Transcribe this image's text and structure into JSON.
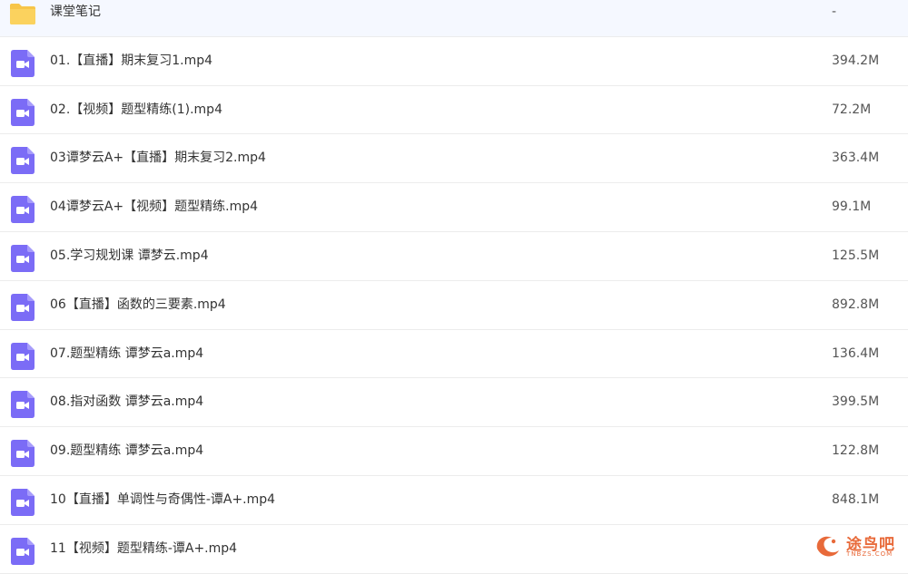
{
  "files": [
    {
      "name": "课堂笔记",
      "size": "-",
      "type": "folder",
      "icon": "folder-icon"
    },
    {
      "name": "01.【直播】期末复习1.mp4",
      "size": "394.2M",
      "type": "video",
      "icon": "video-icon"
    },
    {
      "name": "02.【视频】题型精练(1).mp4",
      "size": "72.2M",
      "type": "video",
      "icon": "video-icon"
    },
    {
      "name": "03谭梦云A+【直播】期末复习2.mp4",
      "size": "363.4M",
      "type": "video",
      "icon": "video-icon"
    },
    {
      "name": "04谭梦云A+【视频】题型精练.mp4",
      "size": "99.1M",
      "type": "video",
      "icon": "video-icon"
    },
    {
      "name": "05.学习规划课 谭梦云.mp4",
      "size": "125.5M",
      "type": "video",
      "icon": "video-icon"
    },
    {
      "name": "06【直播】函数的三要素.mp4",
      "size": "892.8M",
      "type": "video",
      "icon": "video-icon"
    },
    {
      "name": "07.题型精练 谭梦云a.mp4",
      "size": "136.4M",
      "type": "video",
      "icon": "video-icon"
    },
    {
      "name": "08.指对函数 谭梦云a.mp4",
      "size": "399.5M",
      "type": "video",
      "icon": "video-icon"
    },
    {
      "name": "09.题型精练 谭梦云a.mp4",
      "size": "122.8M",
      "type": "video",
      "icon": "video-icon"
    },
    {
      "name": "10【直播】单调性与奇偶性-谭A+.mp4",
      "size": "848.1M",
      "type": "video",
      "icon": "video-icon"
    },
    {
      "name": "11【视频】题型精练-谭A+.mp4",
      "size": "",
      "type": "video",
      "icon": "video-icon"
    }
  ],
  "watermark": {
    "text": "途鸟吧",
    "sub": "TNBZS.COM"
  },
  "colors": {
    "folder": "#f7c548",
    "video": "#7b6cf6",
    "watermark": "#e86a3a"
  }
}
